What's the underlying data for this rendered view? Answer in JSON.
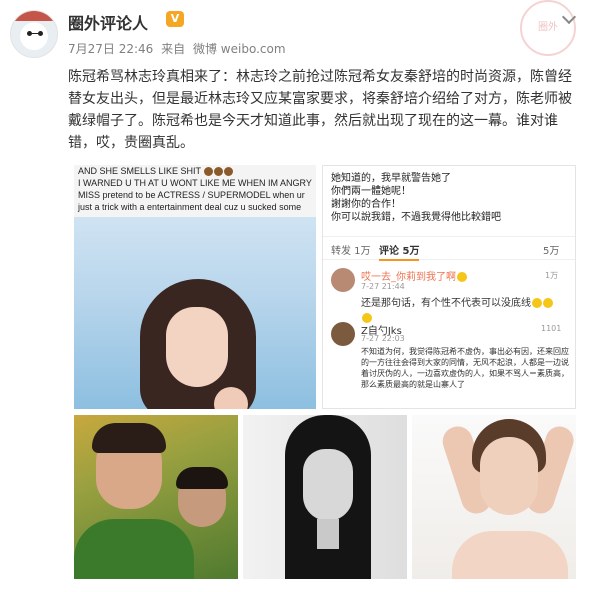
{
  "post": {
    "username": "圈外评论人",
    "vip_badge": "V",
    "date": "7月27日 22:46",
    "source_prefix": "来自",
    "source": "微博 weibo.com",
    "text": "陈冠希骂林志玲真相来了：林志玲之前抢过陈冠希女友秦舒培的时尚资源，陈曾经替女友出头，但是最近林志玲又应某富家要求，将秦舒培介绍给了对方，陈老师被戴绿帽子了。陈冠希也是今天才知道此事，然后就出现了现在的这一幕。谁对谁错，哎，贵圈真乱。",
    "stamp_text": "圈外"
  },
  "images": {
    "instagram_quote": [
      "AND SHE SMELLS LIKE SHIT",
      "I WARNED U TH AT U WONT LIKE ME WHEN IM ANGRY",
      "MISS pretend to be ACTRESS / SUPERMODEL when ur",
      "just a trick with a entertainment deal cuz u sucked some"
    ],
    "comment_screenshot": {
      "message_lines": [
        "她知道的，我早就警告她了",
        "你們兩一體她呢！",
        "謝謝你的合作！",
        "你可以說我錯，不過我覺得他比較錯吧"
      ],
      "tabs": [
        {
          "label": "转发 1万"
        },
        {
          "label": "评论 5万"
        },
        {
          "label": "5万"
        }
      ],
      "comments": [
        {
          "name": "哎一去_你莉到我了啊",
          "time": "7-27 21:44",
          "likes": "1万",
          "body": "还是那句话，有个性不代表可以没底线"
        },
        {
          "name": "Z自勺Jks",
          "time": "7-27 22:03",
          "likes": "1101",
          "body": "不知道为何，我觉得陈冠希不虚伪，事出必有因，还来回应的一方往往会得到大家的同情，无风不起浪，人都是一边说着讨厌伪的人，一边喜欢虚伪的人，如果不骂人＝素质高，那么素质最高的就是山寨人了"
        }
      ]
    }
  }
}
